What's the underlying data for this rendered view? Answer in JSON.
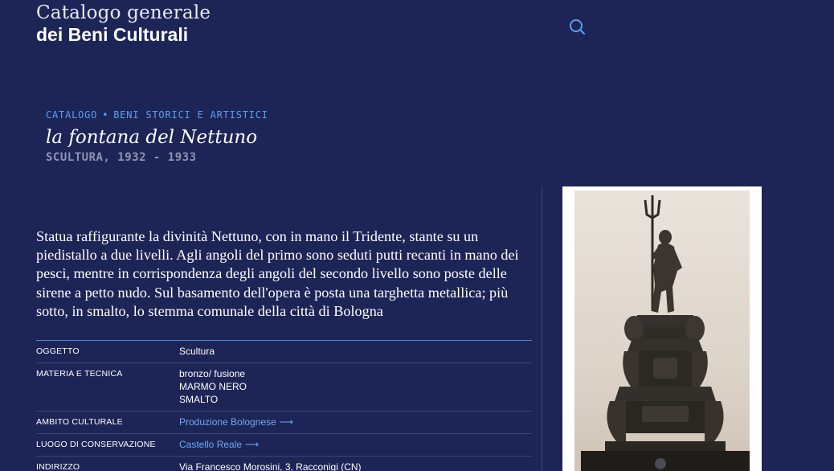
{
  "header": {
    "brand_line1": "Catalogo generale",
    "brand_line2": "dei Beni Culturali",
    "search_icon": "search-icon"
  },
  "breadcrumb": {
    "items": [
      "CATALOGO",
      "BENI STORICI E ARTISTICI"
    ],
    "separator": "•"
  },
  "work": {
    "title": "la fontana del Nettuno",
    "subtitle": "SCULTURA, 1932 - 1933",
    "description": "Statua raffigurante la divinità Nettuno, con in mano il Tridente, stante su un piedistallo a due livelli. Agli angoli del primo sono seduti putti recanti in mano dei pesci, mentre in corrispondenza degli angoli del secondo livello sono poste delle sirene a petto nudo. Sul basamento dell'opera è posta una targhetta metallica; più sotto, in smalto, lo stemma comunale della città di Bologna"
  },
  "details": {
    "oggetto": {
      "label": "OGGETTO",
      "value": "Scultura"
    },
    "materia": {
      "label": "MATERIA E TECNICA",
      "values": [
        "bronzo/ fusione",
        "MARMO NERO",
        "SMALTO"
      ]
    },
    "ambito": {
      "label": "AMBITO CULTURALE",
      "value": "Produzione Bolognese",
      "arrow": "⟶"
    },
    "luogo": {
      "label": "LUOGO DI CONSERVAZIONE",
      "value": "Castello Reale",
      "arrow": "⟶"
    },
    "indirizzo": {
      "label": "INDIRIZZO",
      "value": "Via Francesco Morosini, 3, Racconigi (CN)"
    }
  },
  "colors": {
    "background": "#1d2557",
    "accent": "#5b9df0",
    "link": "#6aaaf5",
    "muted": "#8e93b3"
  }
}
